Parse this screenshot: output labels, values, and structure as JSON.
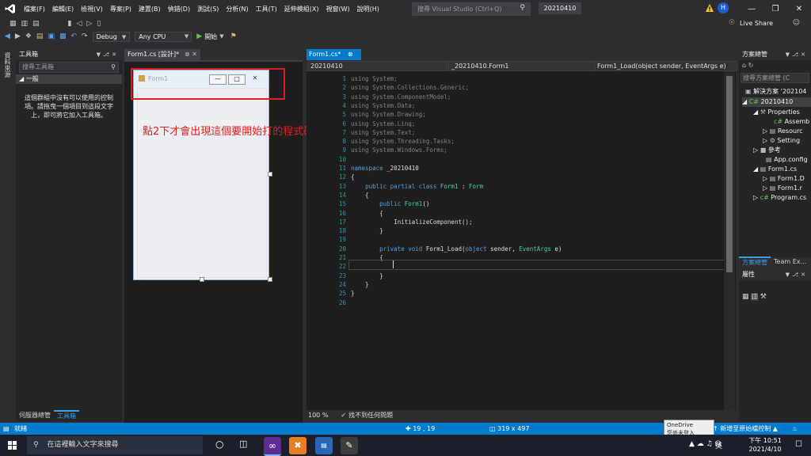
{
  "window": {
    "menus": [
      "檔案(F)",
      "編輯(E)",
      "檢視(V)",
      "專案(P)",
      "建置(B)",
      "偵錯(D)",
      "測試(S)",
      "分析(N)",
      "工具(T)",
      "延伸模組(X)",
      "視窗(W)",
      "說明(H)"
    ],
    "search_placeholder": "搜尋 Visual Studio (Ctrl+Q)",
    "solution_name": "20210410",
    "user_initial": "H",
    "live_share": "Live Share"
  },
  "toolbar": {
    "config": "Debug",
    "platform": "Any CPU",
    "start_label": "開始"
  },
  "left_rail": {
    "label": "資料來源"
  },
  "toolbox": {
    "title": "工具箱",
    "search_placeholder": "搜尋工具箱",
    "group": "一般",
    "empty_message": "這個群組中沒有可以使用的控制項。請拖曳一個項目到這段文字上，即可將它加入工具箱。",
    "tabs": [
      "伺服器總管",
      "工具箱"
    ]
  },
  "designer": {
    "tab_label": "Form1.cs [設計]*",
    "form_title": "Form1",
    "annotation": "點2下才會出現這個要開始打的程式碼"
  },
  "editor": {
    "tab_label": "Form1.cs*",
    "nav_project": "20210410",
    "nav_class": "_20210410.Form1",
    "nav_member": "Form1_Load(object sender, EventArgs e)",
    "zoom": "100 %",
    "issues": "找不到任何問題",
    "lines": [
      {
        "n": "1",
        "t": "using System;"
      },
      {
        "n": "2",
        "t": "using System.Collections.Generic;"
      },
      {
        "n": "3",
        "t": "using System.ComponentModel;"
      },
      {
        "n": "4",
        "t": "using System.Data;"
      },
      {
        "n": "5",
        "t": "using System.Drawing;"
      },
      {
        "n": "6",
        "t": "using System.Linq;"
      },
      {
        "n": "7",
        "t": "using System.Text;"
      },
      {
        "n": "8",
        "t": "using System.Threading.Tasks;"
      },
      {
        "n": "9",
        "t": "using System.Windows.Forms;"
      },
      {
        "n": "10",
        "t": ""
      },
      {
        "n": "11",
        "t": "namespace _20210410"
      },
      {
        "n": "12",
        "t": "{"
      },
      {
        "n": "13",
        "t": "    public partial class Form1 : Form"
      },
      {
        "n": "14",
        "t": "    {"
      },
      {
        "n": "15",
        "t": "        public Form1()"
      },
      {
        "n": "16",
        "t": "        {"
      },
      {
        "n": "17",
        "t": "            InitializeComponent();"
      },
      {
        "n": "18",
        "t": "        }"
      },
      {
        "n": "19",
        "t": ""
      },
      {
        "n": "20",
        "t": "        private void Form1_Load(object sender, EventArgs e)"
      },
      {
        "n": "21",
        "t": "        {"
      },
      {
        "n": "22",
        "t": ""
      },
      {
        "n": "23",
        "t": "        }"
      },
      {
        "n": "24",
        "t": "    }"
      },
      {
        "n": "25",
        "t": "}"
      },
      {
        "n": "26",
        "t": ""
      }
    ]
  },
  "solution_explorer": {
    "title": "方案總管",
    "search_placeholder": "搜尋方案總管 (C",
    "items": [
      {
        "label": "解決方案 '202104"
      },
      {
        "label": "20210410"
      },
      {
        "label": "Properties"
      },
      {
        "label": "Assemb"
      },
      {
        "label": "Resourc"
      },
      {
        "label": "Setting"
      },
      {
        "label": "參考"
      },
      {
        "label": "App.config"
      },
      {
        "label": "Form1.cs"
      },
      {
        "label": "Form1.D"
      },
      {
        "label": "Form1.r"
      },
      {
        "label": "Program.cs"
      }
    ],
    "tabs": [
      "方案總管",
      "Team Ex..."
    ]
  },
  "properties": {
    "title": "屬性"
  },
  "statusbar": {
    "ready": "就緒",
    "cursor": "19 , 19",
    "size": "319 x 497",
    "source_control": "新增至原始檔控制",
    "onedrive_title": "OneDrive",
    "onedrive_sub": "您尚未登入"
  },
  "taskbar": {
    "search_placeholder": "在這裡輸入文字來搜尋",
    "time": "下午 10:51",
    "date": "2021/4/10",
    "ime": "英"
  }
}
